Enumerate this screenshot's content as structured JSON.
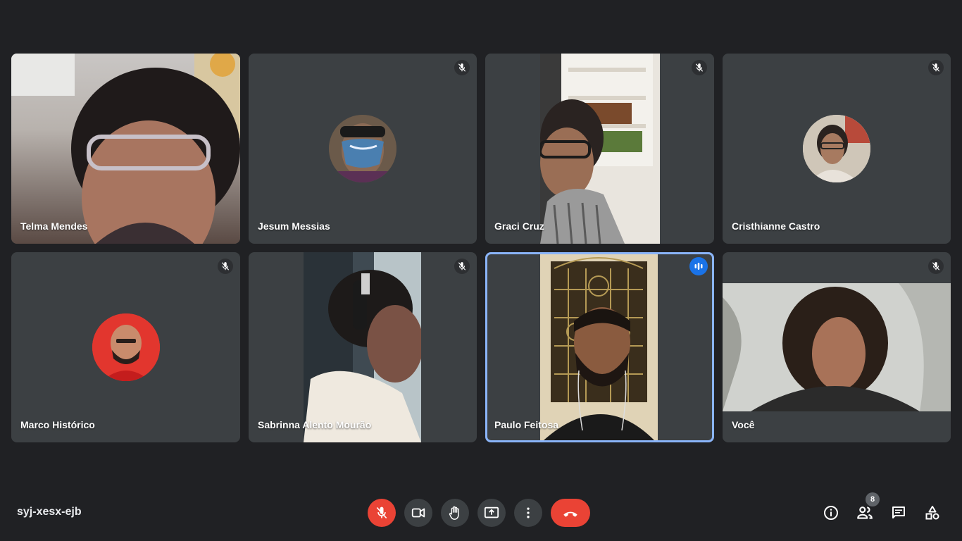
{
  "participants": [
    {
      "name": "Telma Mendes"
    },
    {
      "name": "Jesum Messias"
    },
    {
      "name": "Graci Cruz"
    },
    {
      "name": "Cristhianne Castro"
    },
    {
      "name": "Marco Histórico"
    },
    {
      "name": "Sabrinna Alento Mourão"
    },
    {
      "name": "Paulo Feitosa"
    },
    {
      "name": "Você"
    }
  ],
  "meeting": {
    "code": "syj-xesx-ejb"
  },
  "controls": {
    "mic": "mic-off-icon",
    "camera": "camera-icon",
    "raise_hand": "hand-icon",
    "present": "present-screen-icon",
    "more": "more-options-icon",
    "leave": "hang-up-icon"
  },
  "right_panel": {
    "participants_count": "8"
  },
  "colors": {
    "background": "#202124",
    "tile": "#3c4043",
    "danger": "#ea4335",
    "accent": "#1a73e8",
    "speaking_border": "#8ab4f8"
  }
}
